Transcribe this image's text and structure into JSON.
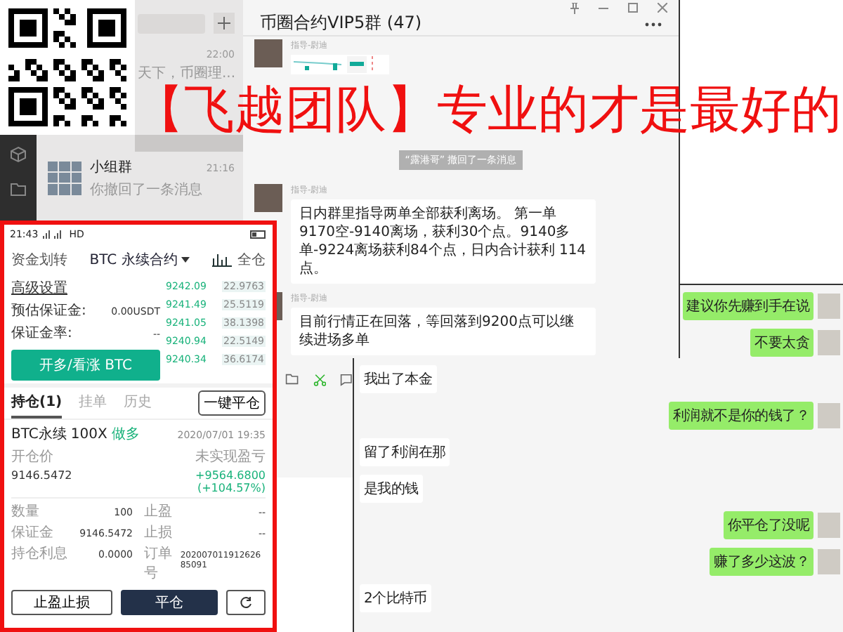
{
  "headline": "【飞越团队】专业的才是最好的",
  "wechat": {
    "chat_list": [
      {
        "time": "22:00",
        "preview": "天下，币圈理...",
        "selected": false
      },
      {
        "selected": true
      },
      {
        "name": "小组群",
        "time": "21:16",
        "preview": "你撤回了一条消息",
        "selected": false
      }
    ],
    "chat_title": "币圈合约VIP5群 (47)",
    "messages": [
      {
        "kind": "image",
        "sender": "指导-尉迪"
      },
      {
        "kind": "notice",
        "text": "“露港哥” 撤回了一条消息"
      },
      {
        "kind": "text",
        "sender": "指导-尉迪",
        "text": "日内群里指导两单全部获利离场。 第一单9170空-9140离场，获利30个点。9140多单-9224离场获利84个点，日内合计获利 114点。"
      },
      {
        "kind": "text",
        "sender": "指导-尉迪",
        "text": "目前行情正在回落，等回落到9200点可以继续进场多单"
      }
    ]
  },
  "phone": {
    "time": "21:43",
    "network": "HD",
    "transfer": "资金划转",
    "contract": "BTC 永续合约",
    "margin_mode": "全仓",
    "settings_link": "高级设置",
    "fields": [
      {
        "label": "预估保证金:",
        "value": "0.00USDT"
      },
      {
        "label": "保证金率:",
        "value": "--"
      }
    ],
    "open_long_button": "开多/看涨 BTC",
    "order_book": [
      {
        "price": "9242.09",
        "amount": "22.9763"
      },
      {
        "price": "9241.49",
        "amount": "25.5119"
      },
      {
        "price": "9241.05",
        "amount": "38.1398"
      },
      {
        "price": "9240.94",
        "amount": "22.5149"
      },
      {
        "price": "9240.34",
        "amount": "36.6174"
      }
    ],
    "tabs": [
      {
        "label": "持仓(1)",
        "selected": true
      },
      {
        "label": "挂单",
        "selected": false
      },
      {
        "label": "历史",
        "selected": false
      }
    ],
    "close_all_button": "一键平仓",
    "position": {
      "symbol": "BTC永续",
      "leverage": "100X",
      "side": "做多",
      "date": "2020/07/01 19:35",
      "entry_label": "开仓价",
      "pnl_label": "未实现盈亏",
      "entry_price": "9146.5472",
      "pnl": "+9564.6800",
      "pnl_percent": "(+104.57%)",
      "details": [
        {
          "label": "数量",
          "value": "100"
        },
        {
          "label": "止盈",
          "value": "--"
        },
        {
          "label": "保证金",
          "value": "9146.5472"
        },
        {
          "label": "止损",
          "value": "--"
        },
        {
          "label": "持仓利息",
          "value": "0.0000"
        },
        {
          "label": "订单号",
          "value": "20200701191262685091"
        }
      ],
      "buttons": [
        "止盈止损",
        "平仓"
      ]
    }
  },
  "chat2": {
    "messages": [
      {
        "kind": "sent",
        "text": "建议你先赚到手在说"
      },
      {
        "kind": "sent",
        "text": "不要太贪"
      },
      {
        "kind": "received",
        "text": "我出了本金"
      },
      {
        "kind": "sent",
        "text": "利润就不是你的钱了？"
      },
      {
        "kind": "received",
        "text": "留了利润在那"
      },
      {
        "kind": "received",
        "text": "是我的钱"
      },
      {
        "kind": "sent",
        "text": "你平仓了没呢"
      },
      {
        "kind": "sent",
        "text": "赚了多少这波？"
      },
      {
        "kind": "received",
        "text": "2个比特币"
      }
    ]
  }
}
